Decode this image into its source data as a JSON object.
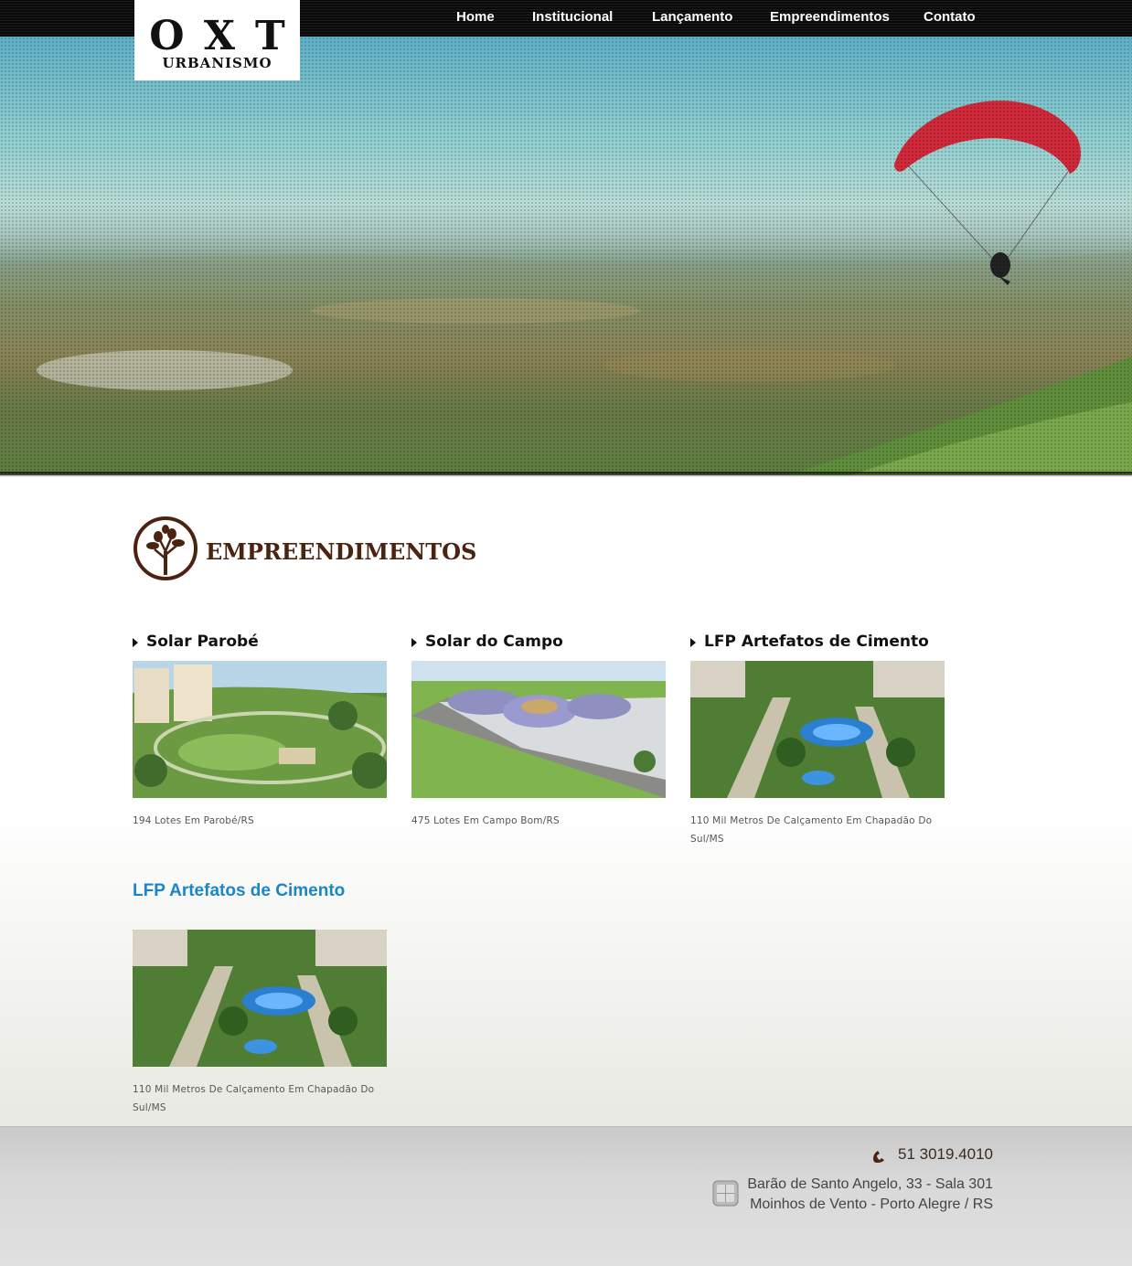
{
  "brand": {
    "mark": "OXT",
    "sub": "URBANISMO"
  },
  "nav": [
    {
      "label": "Home"
    },
    {
      "label": "Institucional"
    },
    {
      "label": "Lançamento"
    },
    {
      "label": "Empreendimentos"
    },
    {
      "label": "Contato"
    }
  ],
  "section": {
    "title": "EMPREENDIMENTOS",
    "icon": "tree-icon"
  },
  "cards": [
    {
      "title": "Solar Parobé",
      "desc": "194 Lotes Em Parobé/RS"
    },
    {
      "title": "Solar do Campo",
      "desc": "475 Lotes Em Campo Bom/RS"
    },
    {
      "title": "LFP Artefatos de Cimento",
      "desc": "110 Mil Metros De Calçamento Em Chapadão Do Sul/MS"
    }
  ],
  "featured": {
    "title": "LFP Artefatos de Cimento",
    "desc": "110 Mil Metros De Calçamento Em Chapadão Do Sul/MS"
  },
  "footer": {
    "phone": "51 3019.4010",
    "address_line1": "Barão de Santo Angelo, 33 - Sala 301",
    "address_line2": "Moinhos de Vento - Porto Alegre / RS"
  },
  "colors": {
    "title_brown": "#4a2410",
    "link_blue": "#1a86c8",
    "nav_bg": "#111111"
  }
}
